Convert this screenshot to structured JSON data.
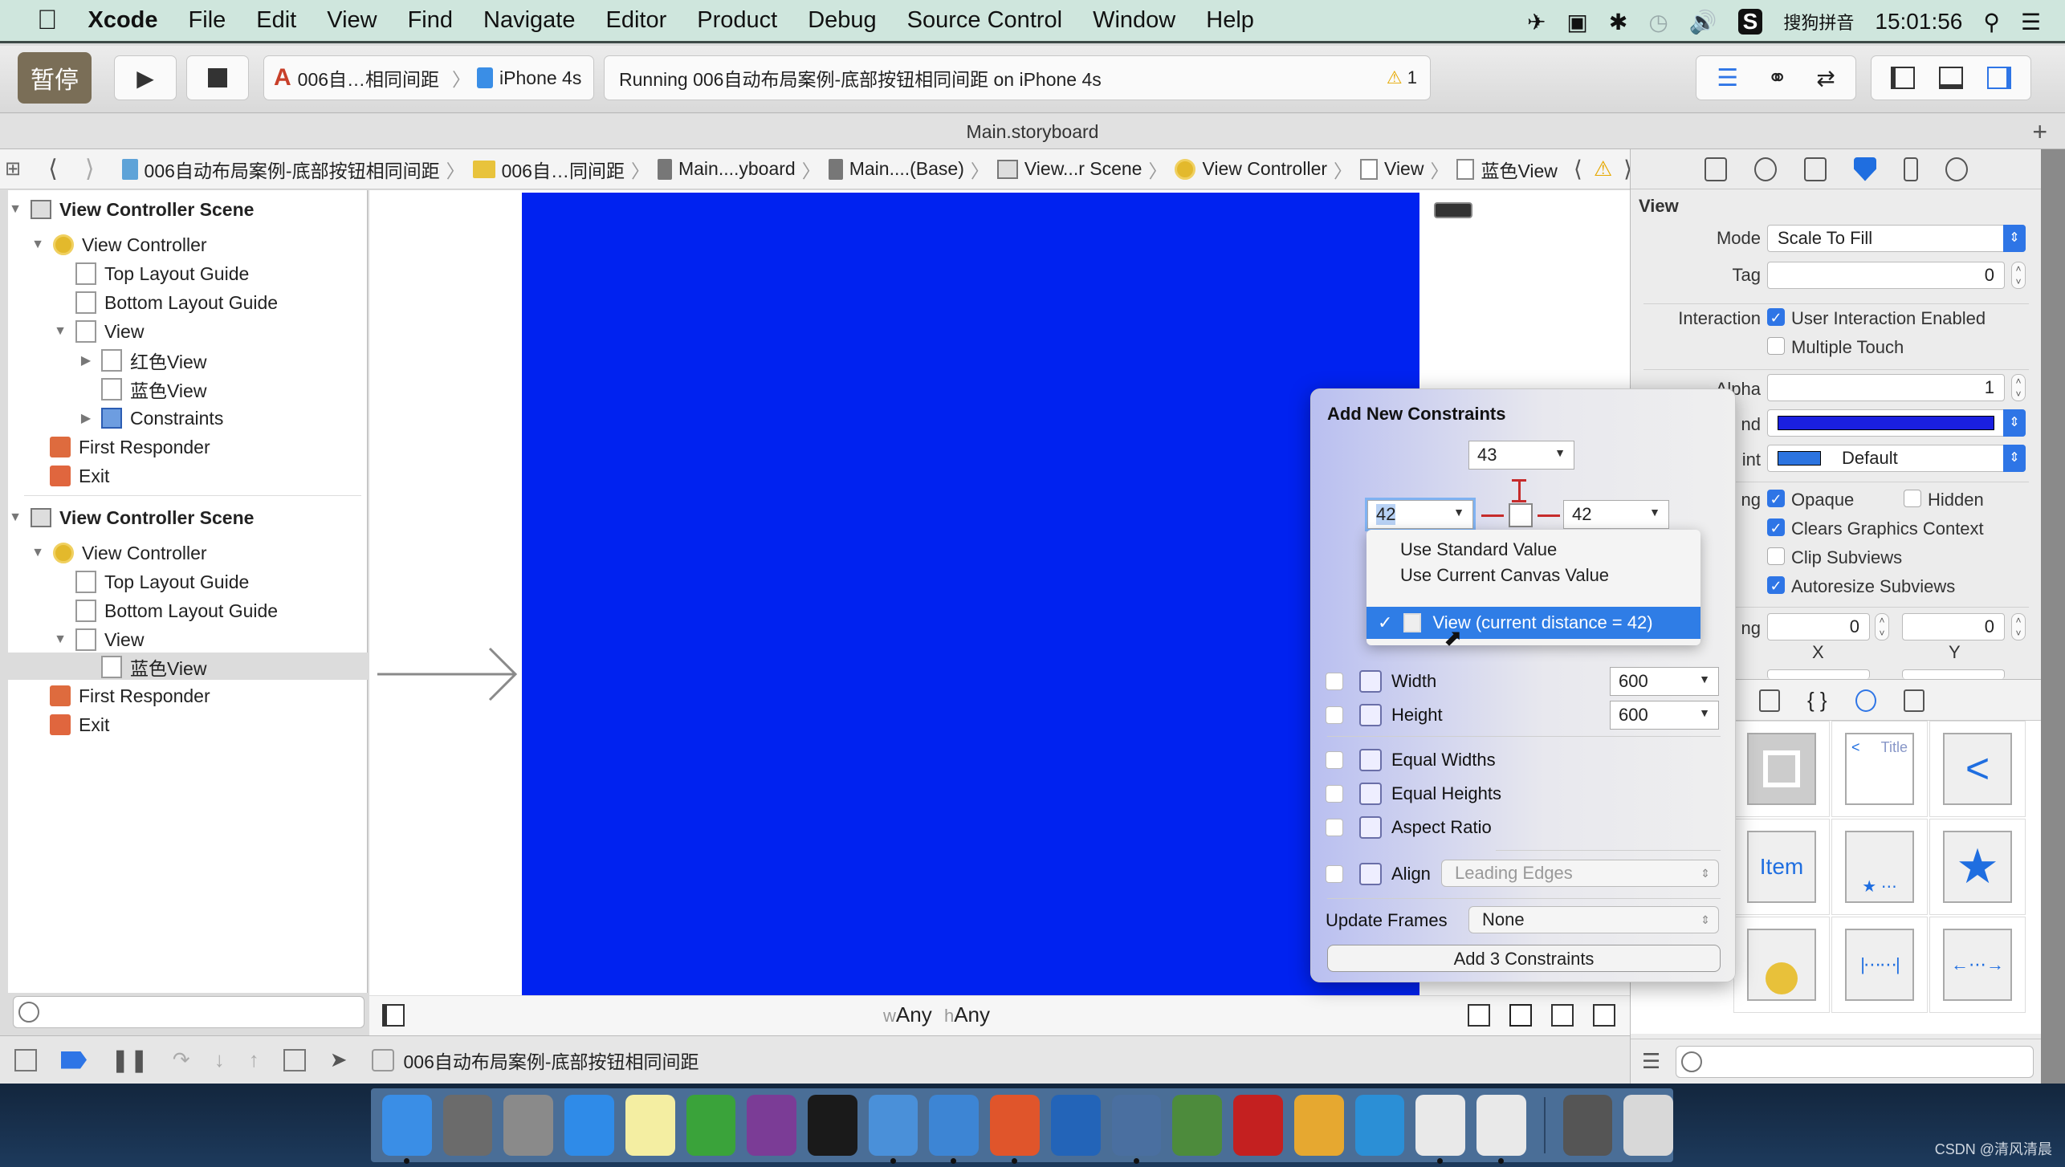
{
  "menubar": {
    "app": "Xcode",
    "items": [
      "File",
      "Edit",
      "View",
      "Find",
      "Navigate",
      "Editor",
      "Product",
      "Debug",
      "Source Control",
      "Window",
      "Help"
    ],
    "input_method": "搜狗拼音",
    "clock": "15:01:56"
  },
  "toolbar": {
    "pause_badge": "暂停",
    "scheme": "006自…相同间距",
    "device": "iPhone 4s",
    "status": "Running 006自动布局案例-底部按钮相同间距 on iPhone 4s",
    "warning_count": "1"
  },
  "tab": {
    "title": "Main.storyboard"
  },
  "jumpbar": [
    "006自动布局案例-底部按钮相同间距",
    "006自…同间距",
    "Main....yboard",
    "Main....(Base)",
    "View...r Scene",
    "View Controller",
    "View",
    "蓝色View"
  ],
  "outline": {
    "scenes": [
      {
        "title": "View Controller Scene",
        "items": [
          {
            "label": "View Controller",
            "level": 1,
            "icon": "view-controller-icon",
            "expanded": true
          },
          {
            "label": "Top Layout Guide",
            "level": 2,
            "icon": "layout-guide-icon"
          },
          {
            "label": "Bottom Layout Guide",
            "level": 2,
            "icon": "layout-guide-icon"
          },
          {
            "label": "View",
            "level": 2,
            "icon": "view-icon",
            "expanded": true
          },
          {
            "label": "红色View",
            "level": 3,
            "icon": "view-icon",
            "collapsed": true
          },
          {
            "label": "蓝色View",
            "level": 3,
            "icon": "view-icon"
          },
          {
            "label": "Constraints",
            "level": 3,
            "icon": "constraints-icon",
            "collapsed": true
          },
          {
            "label": "First Responder",
            "level": 1,
            "icon": "first-responder-icon"
          },
          {
            "label": "Exit",
            "level": 1,
            "icon": "exit-icon"
          }
        ]
      },
      {
        "title": "View Controller Scene",
        "items": [
          {
            "label": "View Controller",
            "level": 1,
            "icon": "view-controller-icon",
            "expanded": true
          },
          {
            "label": "Top Layout Guide",
            "level": 2,
            "icon": "layout-guide-icon"
          },
          {
            "label": "Bottom Layout Guide",
            "level": 2,
            "icon": "layout-guide-icon"
          },
          {
            "label": "View",
            "level": 2,
            "icon": "view-icon",
            "expanded": true
          },
          {
            "label": "蓝色View",
            "level": 3,
            "icon": "view-icon",
            "selected": true
          },
          {
            "label": "First Responder",
            "level": 1,
            "icon": "first-responder-icon"
          },
          {
            "label": "Exit",
            "level": 1,
            "icon": "exit-icon"
          }
        ]
      }
    ]
  },
  "canvas": {
    "view_color": "#0022f0",
    "size_class_w_prefix": "w",
    "size_class_w": "Any",
    "size_class_h_prefix": "h",
    "size_class_h": "Any"
  },
  "debugbar": {
    "target": "006自动布局案例-底部按钮相同间距"
  },
  "inspector": {
    "section": "View",
    "mode_label": "Mode",
    "mode_value": "Scale To Fill",
    "tag_label": "Tag",
    "tag_value": "0",
    "interaction_label": "Interaction",
    "user_interaction": {
      "label": "User Interaction Enabled",
      "checked": true
    },
    "multiple_touch": {
      "label": "Multiple Touch",
      "checked": false
    },
    "alpha_label": "Alpha",
    "alpha_value": "1",
    "background_label": "nd",
    "background_color": "#1a1fe0",
    "tint_label": "int",
    "tint_value": "Default",
    "tint_color": "#2c74e0",
    "drawing_label": "ng",
    "opaque": {
      "label": "Opaque",
      "checked": true
    },
    "hidden": {
      "label": "Hidden",
      "checked": false
    },
    "clears": {
      "label": "Clears Graphics Context",
      "checked": true
    },
    "clip": {
      "label": "Clip Subviews",
      "checked": false
    },
    "autoresize": {
      "label": "Autoresize Subviews",
      "checked": true
    },
    "stretching_label": "ng",
    "stretch_x": "0",
    "stretch_y": "0",
    "x_label": "X",
    "y_label": "Y"
  },
  "library": {
    "tiles": [
      "view-tile",
      "navigation-bar-tile",
      "back-button-tile",
      "bar-button-item-tile",
      "tab-bar-tile",
      "tab-bar-item-tile",
      "search-bar-tile",
      "fixed-space-tile",
      "flexible-space-tile"
    ],
    "item_label": "Item",
    "title_label": "Title"
  },
  "popover": {
    "title": "Add New Constraints",
    "top_value": "43",
    "left_value": "42",
    "right_value": "42",
    "width_label": "Width",
    "width_value": "600",
    "height_label": "Height",
    "height_value": "600",
    "equal_widths": "Equal Widths",
    "equal_heights": "Equal Heights",
    "aspect_ratio": "Aspect Ratio",
    "align_label": "Align",
    "align_value": "Leading Edges",
    "update_frames_label": "Update Frames",
    "update_frames_value": "None",
    "add_button": "Add 3 Constraints"
  },
  "dropdown": {
    "items": [
      "Use Standard Value",
      "Use Current Canvas Value"
    ],
    "selected": "View (current distance = 42)"
  },
  "dock": {
    "apps": [
      {
        "name": "finder",
        "color": "#3a8ee6",
        "running": true
      },
      {
        "name": "system-preferences",
        "color": "#6b6b6b"
      },
      {
        "name": "launchpad",
        "color": "#8a8a8a"
      },
      {
        "name": "safari",
        "color": "#2f8be8"
      },
      {
        "name": "notes",
        "color": "#f4eea2"
      },
      {
        "name": "excel",
        "color": "#3aa33a"
      },
      {
        "name": "onenote",
        "color": "#7b3c96"
      },
      {
        "name": "terminal",
        "color": "#1a1a1a"
      },
      {
        "name": "xcode",
        "color": "#4a90d9",
        "running": true
      },
      {
        "name": "instruments",
        "color": "#3d85d4",
        "running": true
      },
      {
        "name": "powerpoint",
        "color": "#e0552b",
        "running": true
      },
      {
        "name": "screenshot",
        "color": "#2364b8"
      },
      {
        "name": "photo-booth",
        "color": "#4a6fa0",
        "running": true
      },
      {
        "name": "pro-app",
        "color": "#4d8b3c"
      },
      {
        "name": "filezilla",
        "color": "#c42020"
      },
      {
        "name": "utility",
        "color": "#e6a830"
      },
      {
        "name": "word",
        "color": "#2b8fd6"
      },
      {
        "name": "document-1",
        "color": "#e9e9e9",
        "running": true
      },
      {
        "name": "document-2",
        "color": "#e9e9e9",
        "running": true
      },
      {
        "name": "screen-recorder",
        "color": "#555"
      },
      {
        "name": "trash",
        "color": "#d8d8d8"
      }
    ]
  },
  "watermark": "CSDN @清风清晨"
}
